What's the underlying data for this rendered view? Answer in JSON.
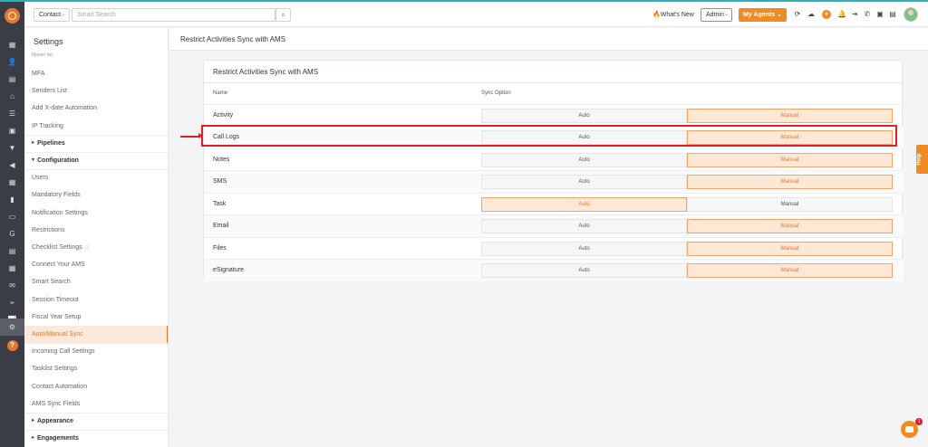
{
  "header": {
    "contact_select": "Contact",
    "search_placeholder": "Smart Search",
    "whats_new": "What's New",
    "admin_select": "Admin",
    "my_agents": "My Agents"
  },
  "settings": {
    "title": "Settings",
    "subtitle": "Master list",
    "items": [
      {
        "label": "MFA",
        "kind": "item"
      },
      {
        "label": "Senders List",
        "kind": "item"
      },
      {
        "label": "Add X-date Automation",
        "kind": "item"
      },
      {
        "label": "IP Tracking",
        "kind": "item"
      },
      {
        "label": "Pipelines",
        "kind": "section"
      },
      {
        "label": "Configuration",
        "kind": "section-open"
      },
      {
        "label": "Users",
        "kind": "item"
      },
      {
        "label": "Mandatory Fields",
        "kind": "item"
      },
      {
        "label": "Notification Settings",
        "kind": "item"
      },
      {
        "label": "Restrictions",
        "kind": "item"
      },
      {
        "label": "Checklist Settings",
        "kind": "item-info"
      },
      {
        "label": "Connect Your AMS",
        "kind": "item"
      },
      {
        "label": "Smart Search",
        "kind": "item"
      },
      {
        "label": "Session Timeout",
        "kind": "item"
      },
      {
        "label": "Fiscal Year Setup",
        "kind": "item"
      },
      {
        "label": "Auto/Manual Sync",
        "kind": "active"
      },
      {
        "label": "Incoming Call Settings",
        "kind": "item"
      },
      {
        "label": "Tasklist Settings",
        "kind": "item"
      },
      {
        "label": "Contact Automation",
        "kind": "item"
      },
      {
        "label": "AMS Sync Fields",
        "kind": "item"
      },
      {
        "label": "Appearance",
        "kind": "section"
      },
      {
        "label": "Engagements",
        "kind": "section"
      }
    ]
  },
  "page": {
    "title": "Restrict Activities Sync with AMS"
  },
  "card": {
    "title": "Restrict Activities Sync with AMS",
    "col_name": "Name",
    "col_sync": "Sync Option",
    "auto_label": "Auto",
    "manual_label": "Manual",
    "rows": [
      {
        "name": "Activity",
        "selected": "Manual"
      },
      {
        "name": "Call Logs",
        "selected": "Manual"
      },
      {
        "name": "Notes",
        "selected": "Manual"
      },
      {
        "name": "SMS",
        "selected": "Manual"
      },
      {
        "name": "Task",
        "selected": "Auto"
      },
      {
        "name": "Email",
        "selected": "Manual"
      },
      {
        "name": "Files",
        "selected": "Manual"
      },
      {
        "name": "eSignature",
        "selected": "Manual"
      }
    ]
  },
  "help_tab": "Help",
  "chat_badge": "1",
  "colors": {
    "accent": "#e8772e",
    "rail": "#3a3d46",
    "highlight": "#e01e26"
  }
}
